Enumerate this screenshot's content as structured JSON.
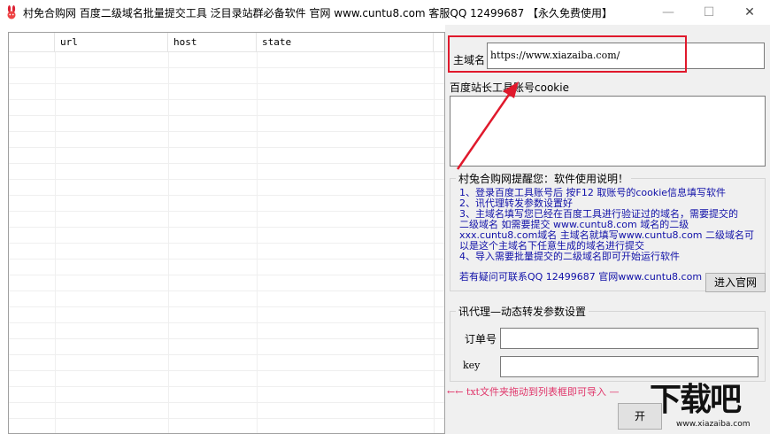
{
  "window": {
    "title": "村免合购网 百度二级域名批量提交工具 泛目录站群必备软件 官网 www.cuntu8.com 客服QQ 12499687 【永久免费使用】",
    "minimize": "—",
    "maximize": "☐",
    "close": "✕"
  },
  "table": {
    "columns": [
      "",
      "url",
      "host",
      "state"
    ],
    "rows": []
  },
  "form": {
    "domain_label": "主域名",
    "domain_value": "https://www.xiazaiba.com/",
    "cookie_label": "百度站长工具账号cookie",
    "cookie_value": ""
  },
  "notice": {
    "legend": "村兔合购网提醒您：软件使用说明！",
    "lines": [
      "1、登录百度工具账号后 按F12 取账号的cookie信息填写软件",
      "2、讯代理转发参数设置好",
      "3、主域名填写您已经在百度工具进行验证过的域名，需要提交的",
      "二级域名 如需要提交 www.cuntu8.com 域名的二级",
      "xxx.cuntu8.com域名 主域名就填写www.cuntu8.com 二级域名可",
      "以是这个主域名下任意生成的域名进行提交",
      "4、导入需要批量提交的二级域名即可开始运行软件"
    ],
    "contact": "若有疑问可联系QQ 12499687 官网www.cuntu8.com",
    "website_button": "进入官网"
  },
  "proxy": {
    "legend": "讯代理—动态转发参数设置",
    "order_label": "订单号",
    "order_value": "",
    "key_label": "key",
    "key_value": ""
  },
  "hint": "←← txt文件夹拖动到列表框即可导入 —",
  "start_button": "开",
  "watermark": {
    "text": "下载吧",
    "url": "www.xiazaiba.com"
  },
  "colors": {
    "annotation_red": "#e0192c",
    "note_blue": "#1010a8",
    "hint_pink": "#e0356a"
  }
}
